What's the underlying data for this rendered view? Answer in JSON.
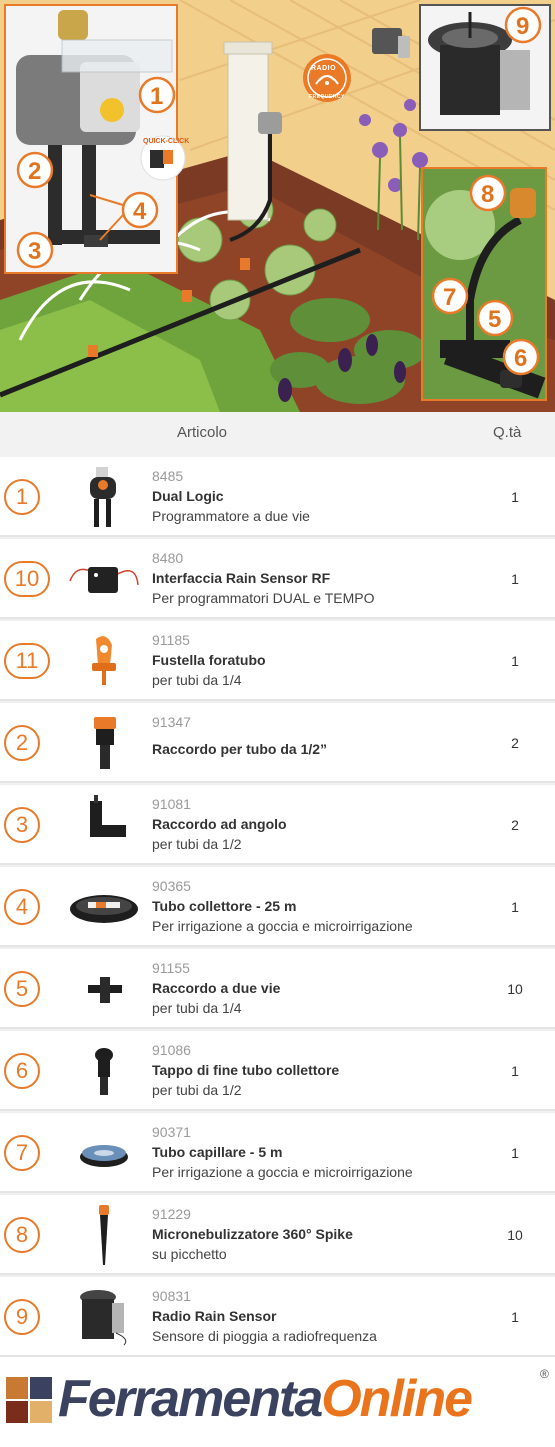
{
  "illustration": {
    "callouts": [
      "1",
      "2",
      "3",
      "4",
      "9",
      "8",
      "7",
      "5",
      "6"
    ],
    "radio_label": "RADIO",
    "radio_sub": "FREQUENCY",
    "quick_click": "QUICK-CLICK",
    "quick_click_sub": "ORIGINAL"
  },
  "table": {
    "header": {
      "articolo": "Articolo",
      "qta": "Q.tà"
    },
    "rows": [
      {
        "num": "1",
        "code": "8485",
        "name": "Dual Logic",
        "desc": "Programmatore a due vie",
        "qty": "1",
        "icon": "dual-logic-timer-icon"
      },
      {
        "num": "10",
        "code": "8480",
        "name": "Interfaccia Rain Sensor RF",
        "desc": "Per programmatori DUAL e TEMPO",
        "qty": "1",
        "icon": "rain-sensor-interface-icon"
      },
      {
        "num": "11",
        "code": "91185",
        "name": "Fustella foratubo",
        "desc": "per tubi da 1/4",
        "qty": "1",
        "icon": "hole-punch-icon"
      },
      {
        "num": "2",
        "code": "91347",
        "name": "Raccordo per tubo da 1/2”",
        "desc": "",
        "qty": "2",
        "icon": "pipe-connector-icon"
      },
      {
        "num": "3",
        "code": "91081",
        "name": "Raccordo ad angolo",
        "desc": "per tubi da 1/2",
        "qty": "2",
        "icon": "elbow-connector-icon"
      },
      {
        "num": "4",
        "code": "90365",
        "name": "Tubo collettore - 25 m",
        "desc": "Per irrigazione a goccia e microirrigazione",
        "qty": "1",
        "icon": "hose-coil-icon"
      },
      {
        "num": "5",
        "code": "91155",
        "name": "Raccordo a due vie",
        "desc": "per tubi da 1/4",
        "qty": "10",
        "icon": "tee-connector-icon"
      },
      {
        "num": "6",
        "code": "91086",
        "name": "Tappo di fine tubo collettore",
        "desc": "per tubi da 1/2",
        "qty": "1",
        "icon": "end-cap-icon"
      },
      {
        "num": "7",
        "code": "90371",
        "name": "Tubo capillare - 5 m",
        "desc": "Per irrigazione a goccia e microirrigazione",
        "qty": "1",
        "icon": "capillary-tube-icon"
      },
      {
        "num": "8",
        "code": "91229",
        "name": "Micronebulizzatore 360° Spike",
        "desc": "su picchetto",
        "qty": "10",
        "icon": "spike-sprayer-icon"
      },
      {
        "num": "9",
        "code": "90831",
        "name": "Radio Rain Sensor",
        "desc": "Sensore di pioggia a radiofrequenza",
        "qty": "1",
        "icon": "rain-sensor-icon"
      }
    ]
  },
  "footer": {
    "logo_part1": "Ferramenta",
    "logo_part2": "Online",
    "registered": "®"
  },
  "colors": {
    "accent": "#e87a2a",
    "logo_dark": "#3a4260",
    "logo_orange": "#e9741c",
    "row_bg": "#ffffff",
    "table_bg": "#f0f0f0"
  }
}
